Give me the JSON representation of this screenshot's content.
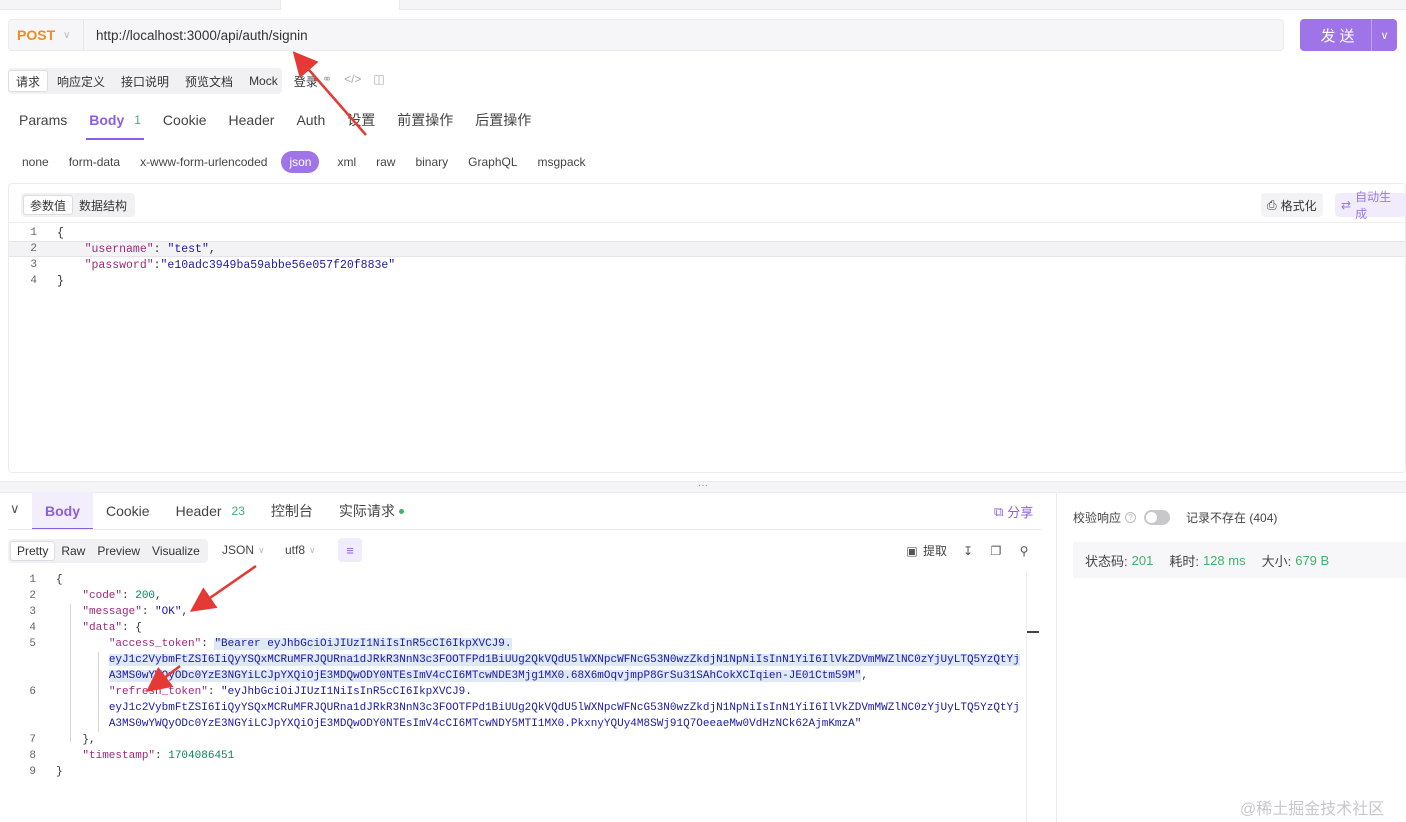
{
  "request": {
    "method": "POST",
    "url": "http://localhost:3000/api/auth/signin",
    "send_label": "发送"
  },
  "doc_tabs": [
    {
      "label": "请求",
      "active": true
    },
    {
      "label": "响应定义"
    },
    {
      "label": "接口说明"
    },
    {
      "label": "预览文档"
    },
    {
      "label": "Mock"
    },
    {
      "label": "登录"
    }
  ],
  "request_tabs": [
    {
      "label": "Params"
    },
    {
      "label": "Body",
      "count": "1",
      "active": true
    },
    {
      "label": "Cookie"
    },
    {
      "label": "Header"
    },
    {
      "label": "Auth"
    },
    {
      "label": "设置"
    },
    {
      "label": "前置操作"
    },
    {
      "label": "后置操作"
    }
  ],
  "body_types": [
    "none",
    "form-data",
    "x-www-form-urlencoded",
    "json",
    "xml",
    "raw",
    "binary",
    "GraphQL",
    "msgpack"
  ],
  "body_type_active": "json",
  "editor": {
    "toggle": [
      "参数值",
      "数据结构"
    ],
    "format_label": "格式化",
    "autogen_label": "自动生成",
    "lines": [
      {
        "n": "1",
        "text": "{"
      },
      {
        "n": "2",
        "key": "\"username\"",
        "sep": ": ",
        "val": "\"test\"",
        "end": ","
      },
      {
        "n": "3",
        "key": "\"password\"",
        "sep": ":",
        "val": "\"e10adc3949ba59abbe56e057f20f883e\"",
        "end": ""
      },
      {
        "n": "4",
        "text": "}"
      }
    ]
  },
  "response_tabs": [
    {
      "label": "Body",
      "active": true
    },
    {
      "label": "Cookie"
    },
    {
      "label": "Header",
      "count": "23"
    },
    {
      "label": "控制台"
    },
    {
      "label": "实际请求"
    }
  ],
  "share_label": "分享",
  "view_modes": [
    "Pretty",
    "Raw",
    "Preview",
    "Visualize"
  ],
  "format_select": "JSON",
  "encoding_select": "utf8",
  "extract_label": "提取",
  "response_lines": [
    {
      "n": "1",
      "text": "{"
    },
    {
      "n": "2",
      "indent": 1,
      "key": "\"code\"",
      "val": "200",
      "type": "num",
      "end": ","
    },
    {
      "n": "3",
      "indent": 1,
      "key": "\"message\"",
      "val": "\"OK\"",
      "type": "str",
      "end": ","
    },
    {
      "n": "4",
      "indent": 1,
      "key": "\"data\"",
      "val": "{",
      "type": "plain",
      "end": ""
    },
    {
      "n": "5",
      "indent": 2,
      "key": "\"access_token\"",
      "val": "\"Bearer eyJhbGciOiJIUzI1NiIsInR5cCI6IkpXVCJ9.",
      "type": "str",
      "end": ""
    },
    {
      "n": "",
      "indent": 2,
      "cont": "eyJ1c2VybmFtZSI6IiQyYSQxMCRuMFRJQURna1dJRkR3NnN3c3FOOTFPd1BiUUg2QkVQdU5lWXNpcWFNcG53N0wzZkdjN1NpNiIsInN1YiI6IlVkZDVmMWZlNC0zYjUyLTQ5YzQtYj"
    },
    {
      "n": "",
      "indent": 2,
      "cont": "A3MS0wYWQyODc0YzE3NGYiLCJpYXQiOjE3MDQwODY0NTEsImV4cCI6MTcwNDE3Mjg1MX0.68X6mOqvjmpP8GrSu31SAhCokXCIqien-JE01Ctm59M\"",
      "end": ","
    },
    {
      "n": "6",
      "indent": 2,
      "key": "\"refresh_token\"",
      "val": "\"eyJhbGciOiJIUzI1NiIsInR5cCI6IkpXVCJ9.",
      "type": "str",
      "end": ""
    },
    {
      "n": "",
      "indent": 2,
      "cont": "eyJ1c2VybmFtZSI6IiQyYSQxMCRuMFRJQURna1dJRkR3NnN3c3FOOTFPd1BiUUg2QkVQdU5lWXNpcWFNcG53N0wzZkdjN1NpNiIsInN1YiI6IlVkZDVmMWZlNC0zYjUyLTQ5YzQtYj"
    },
    {
      "n": "",
      "indent": 2,
      "cont": "A3MS0wYWQyODc0YzE3NGYiLCJpYXQiOjE3MDQwODY0NTEsImV4cCI6MTcwNDY5MTI1MX0.PkxnyYQUy4M8SWj91Q7OeeaeMw0VdHzNCk62AjmKmzA\"",
      "end": ""
    },
    {
      "n": "7",
      "indent": 1,
      "text": "},"
    },
    {
      "n": "8",
      "indent": 1,
      "key": "\"timestamp\"",
      "val": "1704086451",
      "type": "num",
      "end": ""
    },
    {
      "n": "9",
      "text": "}"
    }
  ],
  "right_panel": {
    "validate_label": "校验响应",
    "record_label": "记录不存在 (404)",
    "status_label": "状态码:",
    "status_value": "201",
    "time_label": "耗时:",
    "time_value": "128 ms",
    "size_label": "大小:",
    "size_value": "679 B"
  },
  "watermark": "@稀土掘金技术社区",
  "colors": {
    "accent": "#9e74e8",
    "method": "#f08c1e",
    "success": "#3db36b"
  }
}
